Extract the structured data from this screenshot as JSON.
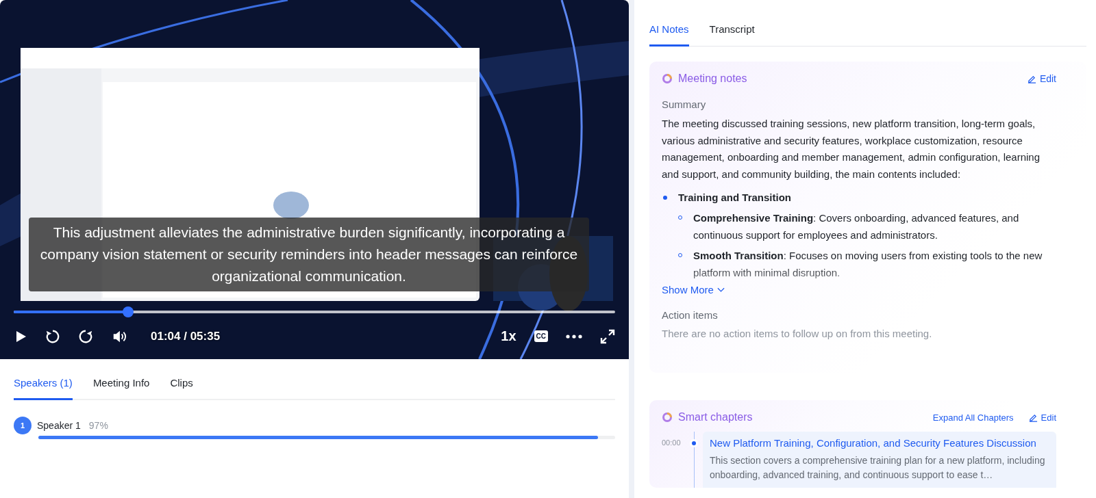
{
  "video": {
    "kind": "picture",
    "caption": "This adjustment alleviates the administrative burden significantly, incorporating a company vision statement or security reminders into header messages can reinforce organizational communication.",
    "progress": {
      "level": 0.19
    },
    "time": "01:04 / 05:35",
    "speed": "1x",
    "cc": "CC"
  },
  "left_tabs": [
    {
      "label": "Speakers (1)",
      "selected": true
    },
    {
      "label": "Meeting Info",
      "selected": false
    },
    {
      "label": "Clips",
      "selected": false
    }
  ],
  "speakers": [
    {
      "badge": "1",
      "name": "Speaker 1",
      "share": "97%",
      "level": 0.97
    }
  ],
  "right_tabs": [
    {
      "label": "AI Notes",
      "selected": true
    },
    {
      "label": "Transcript",
      "selected": false
    }
  ],
  "notes": {
    "title": "Meeting notes",
    "edit": "Edit",
    "summary_label": "Summary",
    "summary": "The meeting discussed training sessions, new platform transition, long-term goals, various administrative and security features, workplace customization, resource management, onboarding and member management, admin configuration, learning and support, and community building, the main contents included:",
    "bullets": [
      {
        "text": "Training and Transition",
        "children": [
          {
            "text": "**Comprehensive Training**: Covers onboarding, advanced features, and continuous support for employees and administrators."
          },
          {
            "text": "**Smooth Transition**: Focuses on moving users from existing tools to the new platform with minimal disruption."
          }
        ]
      }
    ],
    "show_more": "Show More",
    "action_label": "Action items",
    "action_empty": "There are no action items to follow up on from this meeting."
  },
  "chapters": {
    "title": "Smart chapters",
    "expand": "Expand All Chapters",
    "edit": "Edit",
    "items": [
      {
        "time": "00:00",
        "title": "New Platform Training, Configuration, and Security Features Discussion",
        "summary": "This section covers a comprehensive training plan for a new platform, including onboarding, advanced training, and continuous support to ease t…"
      }
    ]
  }
}
